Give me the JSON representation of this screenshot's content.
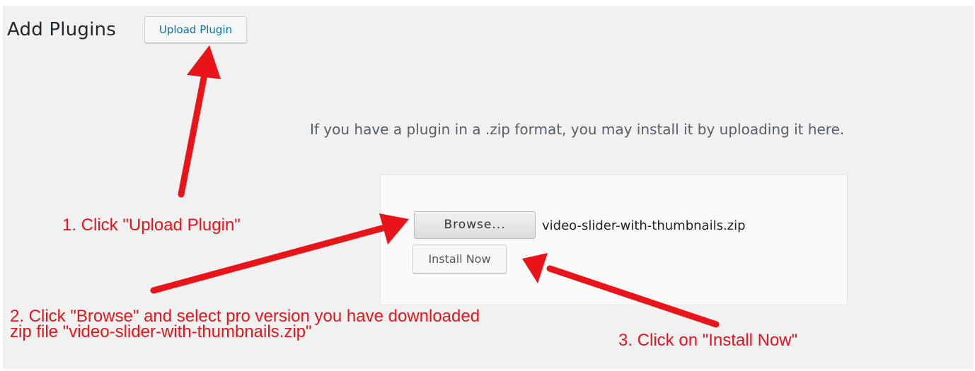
{
  "header": {
    "title": "Add Plugins",
    "upload_button_label": "Upload Plugin"
  },
  "upload_panel": {
    "instructions": "If you have a plugin in a .zip format, you may install it by uploading it here.",
    "browse_label": "Browse...",
    "selected_file": "video-slider-with-thumbnails.zip",
    "install_label": "Install Now"
  },
  "annotations": {
    "step1": "1. Click \"Upload Plugin\"",
    "step2_line1": "2. Click \"Browse\" and select pro version you have downloaded",
    "step2_line2": "zip file \"video-slider-with-thumbnails.zip\"",
    "step3": "3. Click on \"Install Now\""
  },
  "colors": {
    "annotation": "#e8141a",
    "link": "#0073aa",
    "background": "#f1f1f1"
  }
}
